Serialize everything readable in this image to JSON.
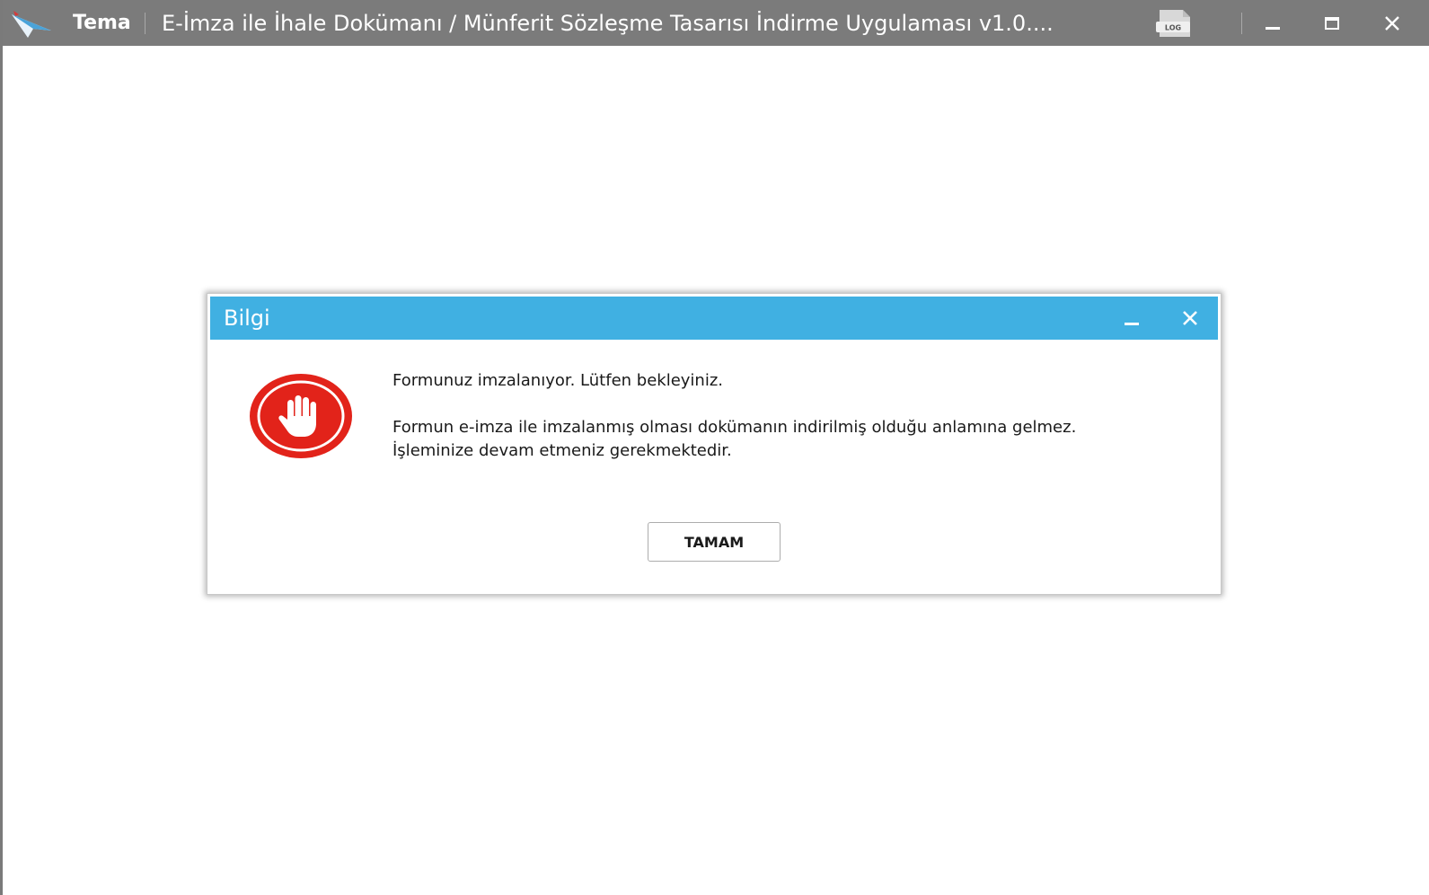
{
  "titlebar": {
    "brand": "Tema",
    "app_title": "E-İmza ile İhale Dokümanı / Münferit Sözleşme Tasarısı İndirme Uygulaması v1.0....",
    "log_label": "LOG",
    "bg_color": "#7b7b7b",
    "icons": {
      "minimize": "minimize-icon",
      "maximize": "maximize-icon",
      "close": "close-icon"
    }
  },
  "dialog": {
    "title": "Bilgi",
    "header_color": "#40b0e2",
    "icon": "stop-hand-icon",
    "icon_color": "#e2231a",
    "message_line1": "Formunuz imzalanıyor. Lütfen bekleyiniz.",
    "message_line2": "Formun e-imza ile imzalanmış olması dokümanın indirilmiş olduğu anlamına gelmez.",
    "message_line3": "İşleminize devam etmeniz gerekmektedir.",
    "ok_label": "TAMAM"
  }
}
